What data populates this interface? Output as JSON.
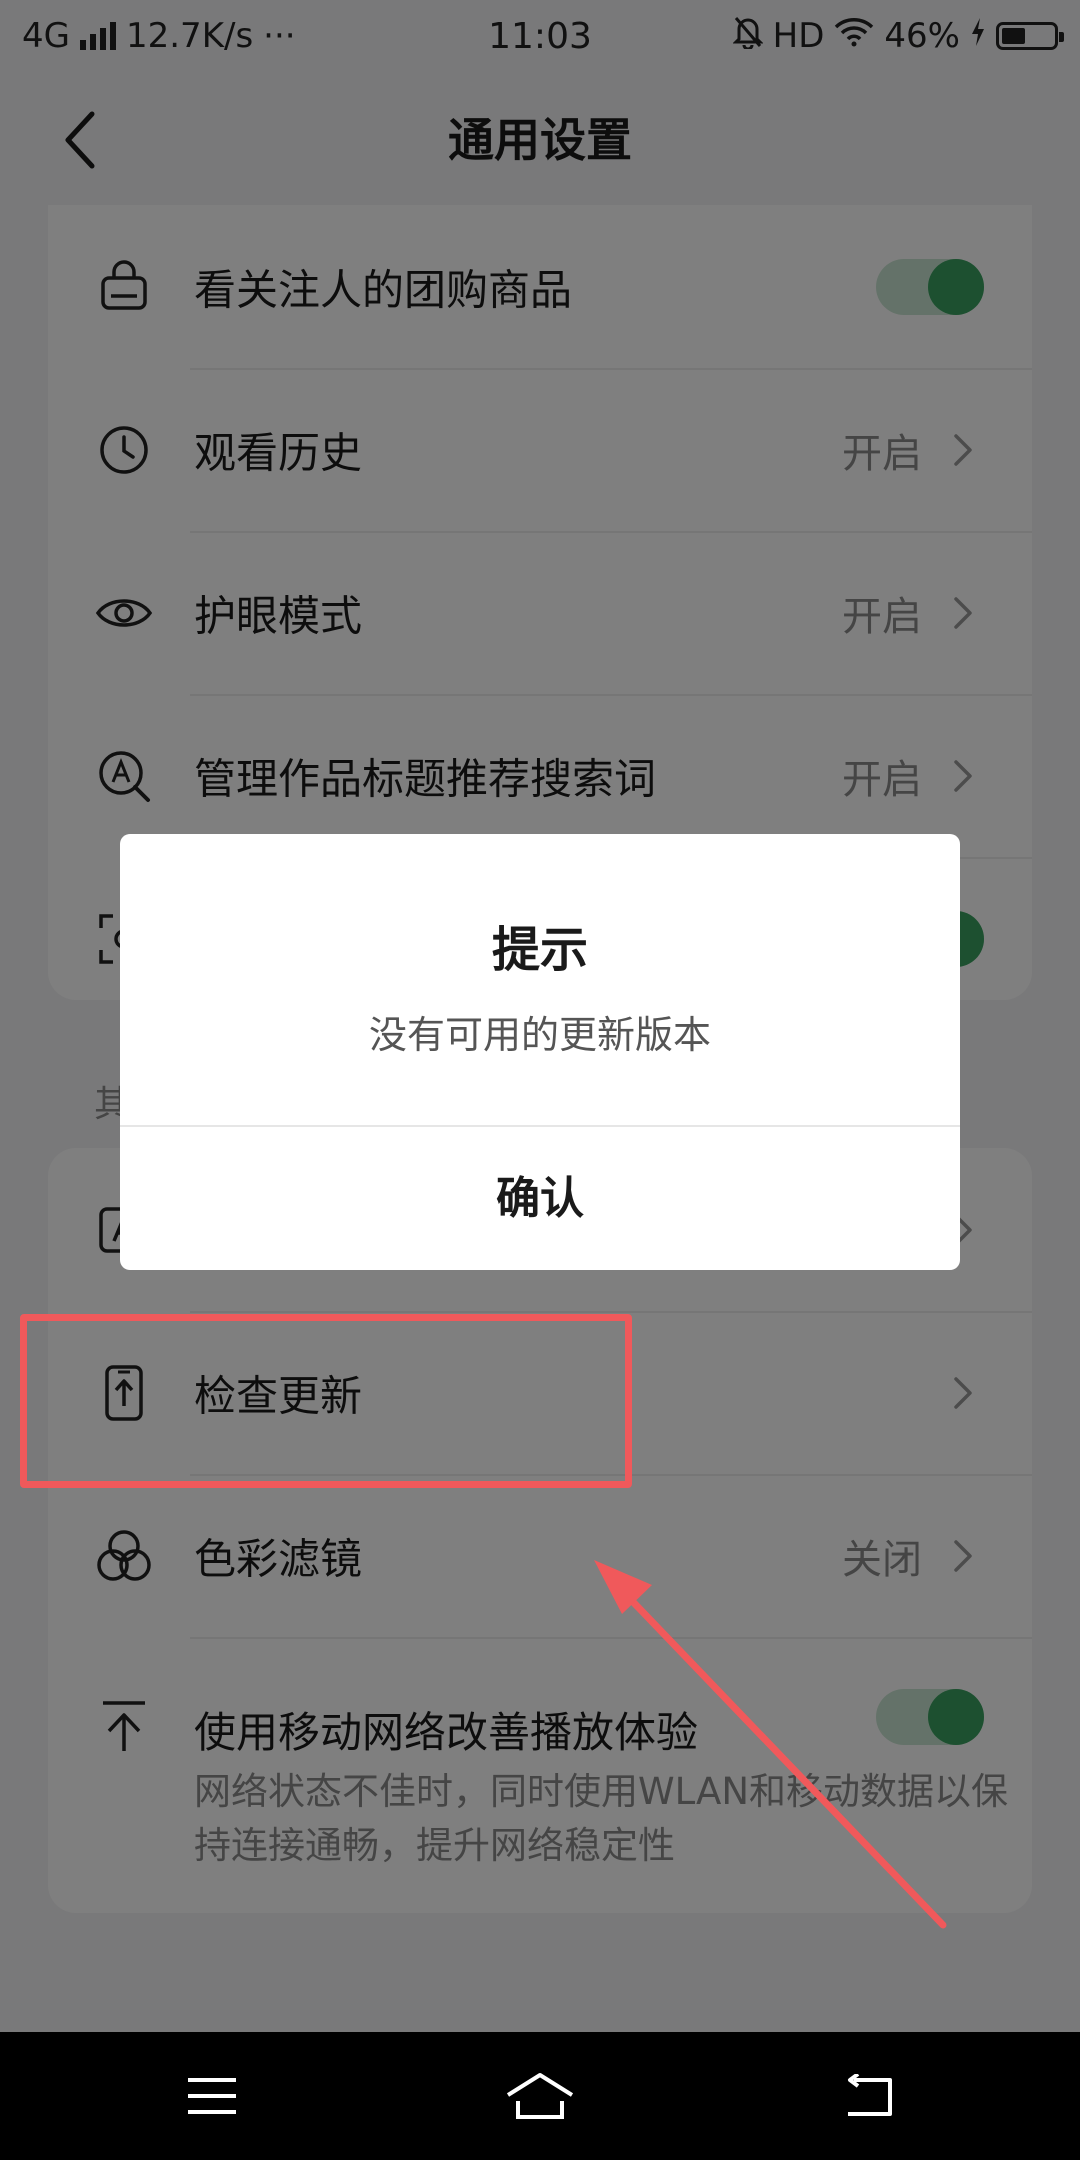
{
  "status_bar": {
    "network": "4G",
    "speed": "12.7K/s",
    "more": "···",
    "time": "11:03",
    "hd": "HD",
    "battery_text": "46%",
    "battery_level_percent": 46
  },
  "header": {
    "title": "通用设置",
    "back_icon": "chevron-left-icon"
  },
  "settings_top": [
    {
      "icon": "shopping-bag-icon",
      "label": "看关注人的团购商品",
      "control": "toggle",
      "on": true
    },
    {
      "icon": "clock-icon",
      "label": "观看历史",
      "value": "开启",
      "control": "chevron"
    },
    {
      "icon": "eye-icon",
      "label": "护眼模式",
      "value": "开启",
      "control": "chevron"
    },
    {
      "icon": "search-letter-icon",
      "label": "管理作品标题推荐搜索词",
      "value": "开启",
      "control": "chevron"
    },
    {
      "icon": "scan-icon",
      "label": "",
      "control": "toggle",
      "on": true
    }
  ],
  "section_label": "其",
  "settings_bottom": [
    {
      "icon": "font-icon",
      "label": "",
      "control": "chevron"
    },
    {
      "icon": "phone-upload-icon",
      "label": "检查更新",
      "control": "chevron"
    },
    {
      "icon": "color-filter-icon",
      "label": "色彩滤镜",
      "value": "关闭",
      "control": "chevron"
    },
    {
      "icon": "upload-arrow-icon",
      "label": "使用移动网络改善播放体验",
      "desc": "网络状态不佳时，同时使用WLAN和移动数据以保持连接通畅，提升网络稳定性",
      "control": "toggle",
      "on": true
    }
  ],
  "dialog": {
    "title": "提示",
    "message": "没有可用的更新版本",
    "confirm": "确认"
  },
  "annotation": {
    "color": "#f0595b"
  },
  "nav_bar": {
    "menu_icon": "menu-icon",
    "home_icon": "home-icon",
    "back_icon": "back-arrow-icon"
  },
  "colors": {
    "toggle_on": "#3aa160",
    "dim_overlay": "rgba(0,0,0,0.5)"
  }
}
